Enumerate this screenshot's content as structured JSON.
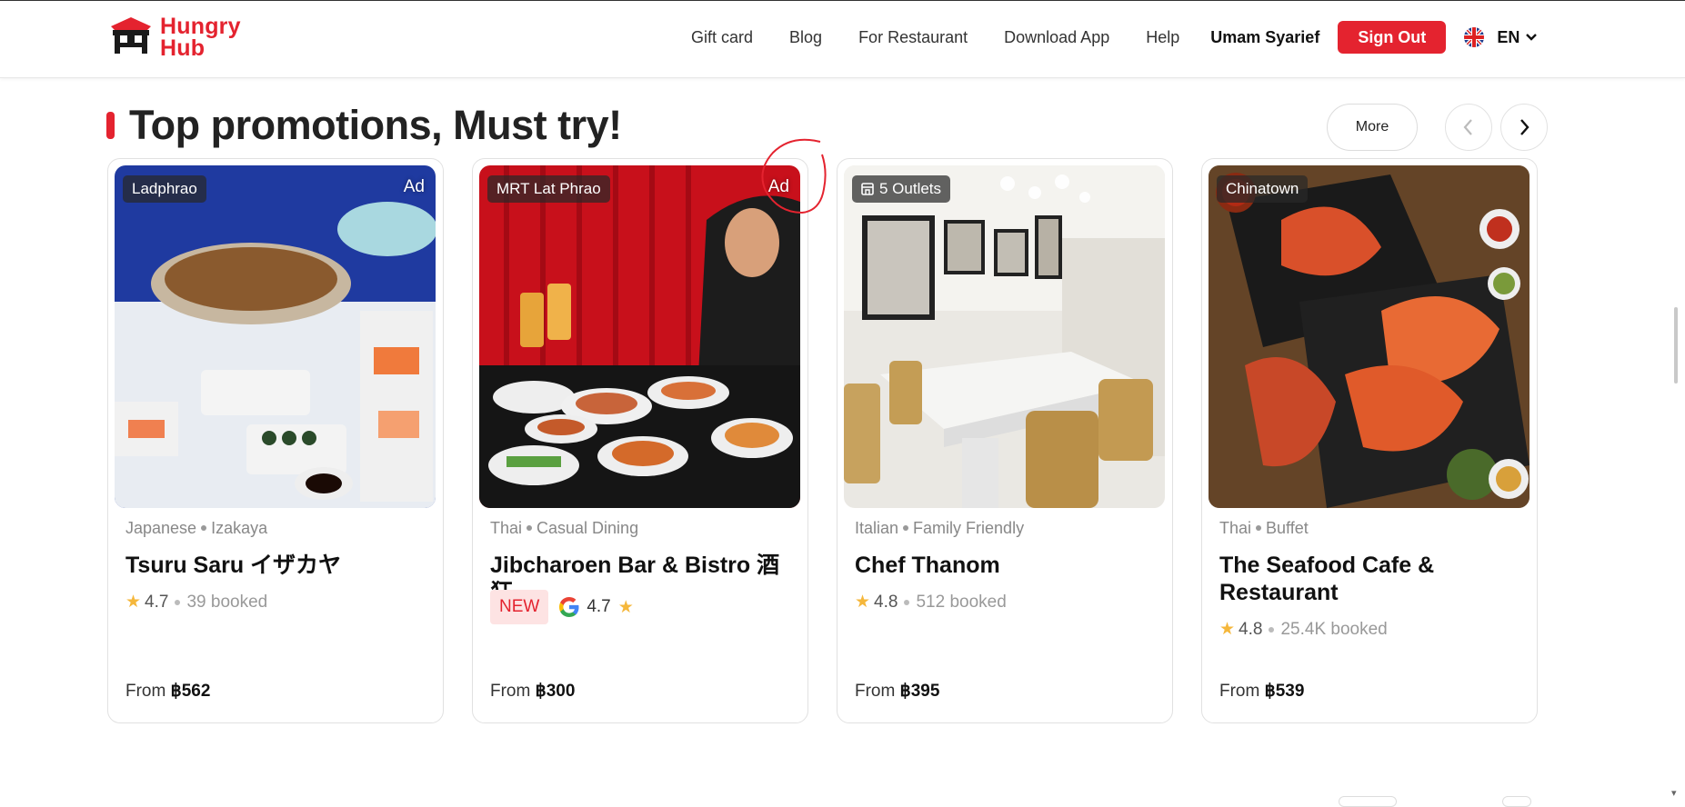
{
  "header": {
    "logo_text_line1": "Hungry",
    "logo_text_line2": "Hub",
    "nav": [
      "Gift card",
      "Blog",
      "For Restaurant",
      "Download App",
      "Help"
    ],
    "user_name": "Umam Syarief",
    "sign_out": "Sign Out",
    "language": "EN"
  },
  "section": {
    "title": "Top promotions, Must try!",
    "more_label": "More"
  },
  "cards": [
    {
      "location": "Ladphrao",
      "ad": "Ad",
      "cuisine1": "Japanese",
      "cuisine2": "Izakaya",
      "name": "Tsuru Saru イザカヤ",
      "rating": "4.7",
      "booked": "39 booked",
      "price_prefix": "From",
      "price": "฿562"
    },
    {
      "location": "MRT Lat Phrao",
      "ad": "Ad",
      "cuisine1": "Thai",
      "cuisine2": "Casual Dining",
      "name": "Jibcharoen Bar & Bistro 酒狂",
      "new_badge": "NEW",
      "rating": "4.7",
      "price_prefix": "From",
      "price": "฿300"
    },
    {
      "location": "5 Outlets",
      "cuisine1": "Italian",
      "cuisine2": "Family Friendly",
      "name": "Chef Thanom",
      "rating": "4.8",
      "booked": "512 booked",
      "price_prefix": "From",
      "price": "฿395"
    },
    {
      "location": "Chinatown",
      "cuisine1": "Thai",
      "cuisine2": "Buffet",
      "name": "The Seafood Cafe & Restaurant",
      "rating": "4.8",
      "booked": "25.4K booked",
      "price_prefix": "From",
      "price": "฿539"
    }
  ],
  "colors": {
    "brand_red": "#e4232f",
    "star": "#f5b73b"
  }
}
